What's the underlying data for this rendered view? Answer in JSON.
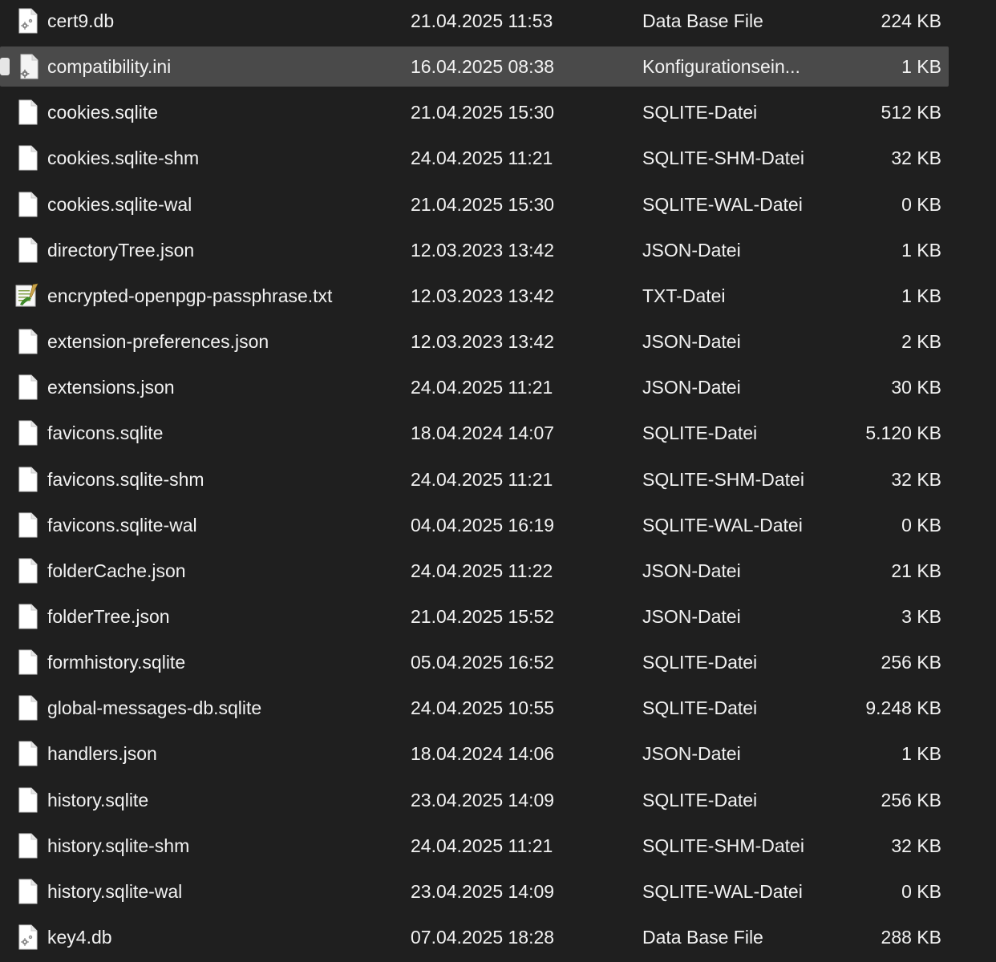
{
  "files": [
    {
      "name": "cert9.db",
      "date": "21.04.2025 11:53",
      "type": "Data Base File",
      "size": "224 KB",
      "icon": "database-file-icon",
      "selected": false
    },
    {
      "name": "compatibility.ini",
      "date": "16.04.2025 08:38",
      "type": "Konfigurationsein...",
      "size": "1 KB",
      "icon": "settings-file-icon",
      "selected": true
    },
    {
      "name": "cookies.sqlite",
      "date": "21.04.2025 15:30",
      "type": "SQLITE-Datei",
      "size": "512 KB",
      "icon": "blank-file-icon",
      "selected": false
    },
    {
      "name": "cookies.sqlite-shm",
      "date": "24.04.2025 11:21",
      "type": "SQLITE-SHM-Datei",
      "size": "32 KB",
      "icon": "blank-file-icon",
      "selected": false
    },
    {
      "name": "cookies.sqlite-wal",
      "date": "21.04.2025 15:30",
      "type": "SQLITE-WAL-Datei",
      "size": "0 KB",
      "icon": "blank-file-icon",
      "selected": false
    },
    {
      "name": "directoryTree.json",
      "date": "12.03.2023 13:42",
      "type": "JSON-Datei",
      "size": "1 KB",
      "icon": "blank-file-icon",
      "selected": false
    },
    {
      "name": "encrypted-openpgp-passphrase.txt",
      "date": "12.03.2023 13:42",
      "type": "TXT-Datei",
      "size": "1 KB",
      "icon": "text-editor-file-icon",
      "selected": false
    },
    {
      "name": "extension-preferences.json",
      "date": "12.03.2023 13:42",
      "type": "JSON-Datei",
      "size": "2 KB",
      "icon": "blank-file-icon",
      "selected": false
    },
    {
      "name": "extensions.json",
      "date": "24.04.2025 11:21",
      "type": "JSON-Datei",
      "size": "30 KB",
      "icon": "blank-file-icon",
      "selected": false
    },
    {
      "name": "favicons.sqlite",
      "date": "18.04.2024 14:07",
      "type": "SQLITE-Datei",
      "size": "5.120 KB",
      "icon": "blank-file-icon",
      "selected": false
    },
    {
      "name": "favicons.sqlite-shm",
      "date": "24.04.2025 11:21",
      "type": "SQLITE-SHM-Datei",
      "size": "32 KB",
      "icon": "blank-file-icon",
      "selected": false
    },
    {
      "name": "favicons.sqlite-wal",
      "date": "04.04.2025 16:19",
      "type": "SQLITE-WAL-Datei",
      "size": "0 KB",
      "icon": "blank-file-icon",
      "selected": false
    },
    {
      "name": "folderCache.json",
      "date": "24.04.2025 11:22",
      "type": "JSON-Datei",
      "size": "21 KB",
      "icon": "blank-file-icon",
      "selected": false
    },
    {
      "name": "folderTree.json",
      "date": "21.04.2025 15:52",
      "type": "JSON-Datei",
      "size": "3 KB",
      "icon": "blank-file-icon",
      "selected": false
    },
    {
      "name": "formhistory.sqlite",
      "date": "05.04.2025 16:52",
      "type": "SQLITE-Datei",
      "size": "256 KB",
      "icon": "blank-file-icon",
      "selected": false
    },
    {
      "name": "global-messages-db.sqlite",
      "date": "24.04.2025 10:55",
      "type": "SQLITE-Datei",
      "size": "9.248 KB",
      "icon": "blank-file-icon",
      "selected": false
    },
    {
      "name": "handlers.json",
      "date": "18.04.2024 14:06",
      "type": "JSON-Datei",
      "size": "1 KB",
      "icon": "blank-file-icon",
      "selected": false
    },
    {
      "name": "history.sqlite",
      "date": "23.04.2025 14:09",
      "type": "SQLITE-Datei",
      "size": "256 KB",
      "icon": "blank-file-icon",
      "selected": false
    },
    {
      "name": "history.sqlite-shm",
      "date": "24.04.2025 11:21",
      "type": "SQLITE-SHM-Datei",
      "size": "32 KB",
      "icon": "blank-file-icon",
      "selected": false
    },
    {
      "name": "history.sqlite-wal",
      "date": "23.04.2025 14:09",
      "type": "SQLITE-WAL-Datei",
      "size": "0 KB",
      "icon": "blank-file-icon",
      "selected": false
    },
    {
      "name": "key4.db",
      "date": "07.04.2025 18:28",
      "type": "Data Base File",
      "size": "288 KB",
      "icon": "database-file-icon",
      "selected": false
    }
  ],
  "colors": {
    "background": "#1f1f1f",
    "text": "#f2f2f2",
    "selected_row": "#4a4a4a"
  }
}
